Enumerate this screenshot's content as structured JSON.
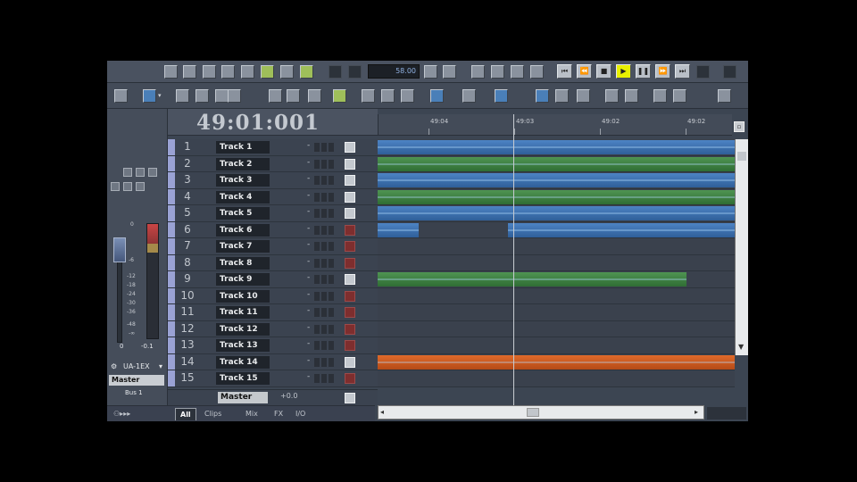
{
  "app": {
    "tempo": "58.00"
  },
  "time": {
    "position": "49:01:001"
  },
  "ruler": {
    "labels": [
      "49:04",
      "49:03",
      "49:02",
      "49:02"
    ]
  },
  "tracks": [
    {
      "num": "1",
      "name": "Track 1",
      "vol_state": "light"
    },
    {
      "num": "2",
      "name": "Track 2",
      "vol_state": "light"
    },
    {
      "num": "3",
      "name": "Track 3",
      "vol_state": "light"
    },
    {
      "num": "4",
      "name": "Track 4",
      "vol_state": "light"
    },
    {
      "num": "5",
      "name": "Track 5",
      "vol_state": "light"
    },
    {
      "num": "6",
      "name": "Track 6",
      "vol_state": "red"
    },
    {
      "num": "7",
      "name": "Track 7",
      "vol_state": "red"
    },
    {
      "num": "8",
      "name": "Track 8",
      "vol_state": "red"
    },
    {
      "num": "9",
      "name": "Track 9",
      "vol_state": "light"
    },
    {
      "num": "10",
      "name": "Track 10",
      "vol_state": "red"
    },
    {
      "num": "11",
      "name": "Track 11",
      "vol_state": "red"
    },
    {
      "num": "12",
      "name": "Track 12",
      "vol_state": "red"
    },
    {
      "num": "13",
      "name": "Track 13",
      "vol_state": "red"
    },
    {
      "num": "14",
      "name": "Track 14",
      "vol_state": "light"
    },
    {
      "num": "15",
      "name": "Track 15",
      "vol_state": "red"
    }
  ],
  "master": {
    "name": "Master",
    "volume": "+0.0"
  },
  "left": {
    "port": "UA-1EX",
    "output": "Master",
    "bus": "Bus 1",
    "fader_value": "0",
    "meter_value": "-0.1",
    "scale": [
      "0",
      "-6",
      "-12",
      "-18",
      "-24",
      "-30",
      "-36",
      "-48",
      "-∞"
    ]
  },
  "clips": [
    {
      "lane": 0,
      "color": "blue",
      "start": 0,
      "end": 1
    },
    {
      "lane": 1,
      "color": "green",
      "start": 0,
      "end": 1
    },
    {
      "lane": 2,
      "color": "blue",
      "start": 0,
      "end": 1
    },
    {
      "lane": 3,
      "color": "green",
      "start": 0,
      "end": 1
    },
    {
      "lane": 4,
      "color": "blue",
      "start": 0,
      "end": 1
    },
    {
      "lane": 5,
      "color": "blue",
      "start": 0,
      "end": 0.115
    },
    {
      "lane": 5,
      "color": "blue",
      "start": 0.365,
      "end": 1
    },
    {
      "lane": 8,
      "color": "green",
      "start": 0,
      "end": 0.865
    },
    {
      "lane": 13,
      "color": "orange",
      "start": 0,
      "end": 1
    }
  ],
  "tabs": [
    "All",
    "Clips",
    "Mix",
    "FX",
    "I/O"
  ]
}
